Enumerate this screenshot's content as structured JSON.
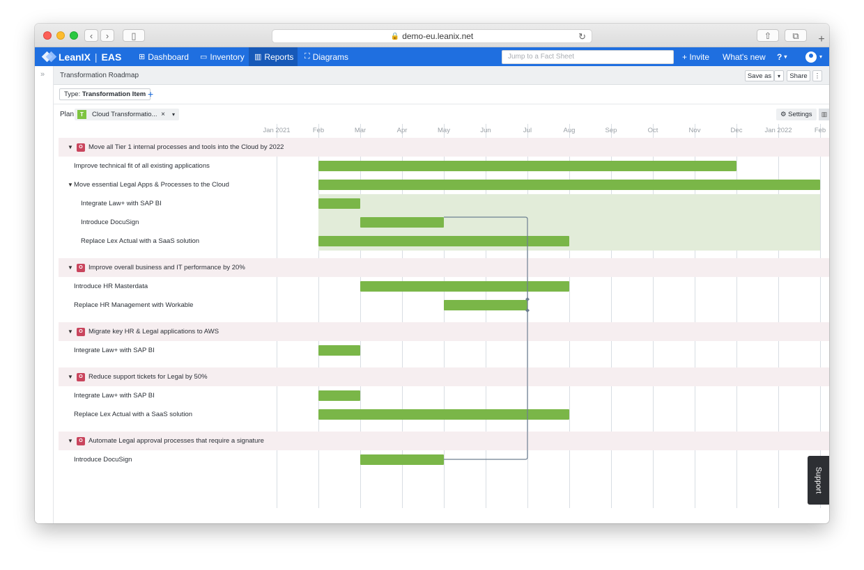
{
  "browser": {
    "url": "demo-eu.leanix.net"
  },
  "nav": {
    "brand": "LeanIX",
    "product": "EAS",
    "items": [
      {
        "label": "Dashboard",
        "icon": "grid-icon",
        "glyph": "⊞"
      },
      {
        "label": "Inventory",
        "icon": "inventory-icon",
        "glyph": "▭"
      },
      {
        "label": "Reports",
        "icon": "reports-icon",
        "glyph": "▥"
      },
      {
        "label": "Diagrams",
        "icon": "diagrams-icon",
        "glyph": "⛶"
      }
    ],
    "search_placeholder": "Jump to a Fact Sheet",
    "invite": "+ Invite",
    "whats_new": "What's new",
    "help": "?"
  },
  "report": {
    "title": "Transformation Roadmap",
    "save_as": "Save as",
    "share": "Share",
    "filter_type_label": "Type:",
    "filter_type_value": "Transformation Item",
    "plan_label": "Plan",
    "plan_badge": "T",
    "plan_value": "Cloud Transformatio...",
    "settings": "Settings"
  },
  "timeline": {
    "months": [
      "Jan 2021",
      "Feb",
      "Mar",
      "Apr",
      "May",
      "Jun",
      "Jul",
      "Aug",
      "Sep",
      "Oct",
      "Nov",
      "Dec",
      "Jan 2022",
      "Feb"
    ]
  },
  "rows": [
    {
      "type": "objective",
      "label": "Move all Tier 1 internal processes and tools into the Cloud by 2022",
      "badge": "O"
    },
    {
      "type": "item",
      "label": "Improve technical fit of all existing applications",
      "indent": 1,
      "start": "2021-02",
      "end": "2021-12"
    },
    {
      "type": "item",
      "label": "Move essential Legal Apps & Processes to the Cloud",
      "indent": 1,
      "expandable": true,
      "start": "2021-02",
      "end": "2022-02"
    },
    {
      "type": "item",
      "label": "Integrate Law+ with SAP BI",
      "indent": 2,
      "start": "2021-02",
      "end": "2021-03"
    },
    {
      "type": "item",
      "label": "Introduce DocuSign",
      "indent": 2,
      "start": "2021-03",
      "end": "2021-05"
    },
    {
      "type": "item",
      "label": "Replace Lex Actual with a SaaS solution",
      "indent": 2,
      "start": "2021-02",
      "end": "2021-08"
    },
    {
      "type": "objective",
      "label": "Improve overall business and IT performance by 20%",
      "badge": "O"
    },
    {
      "type": "item",
      "label": "Introduce HR Masterdata",
      "indent": 1,
      "start": "2021-03",
      "end": "2021-08"
    },
    {
      "type": "item",
      "label": "Replace HR Management with Workable",
      "indent": 1,
      "start": "2021-05",
      "end": "2021-07"
    },
    {
      "type": "objective",
      "label": "Migrate key HR & Legal applications to AWS",
      "badge": "O"
    },
    {
      "type": "item",
      "label": "Integrate Law+ with SAP BI",
      "indent": 1,
      "start": "2021-02",
      "end": "2021-03"
    },
    {
      "type": "objective",
      "label": "Reduce support tickets for Legal by 50%",
      "badge": "O"
    },
    {
      "type": "item",
      "label": "Integrate Law+ with SAP BI",
      "indent": 1,
      "start": "2021-02",
      "end": "2021-03"
    },
    {
      "type": "item",
      "label": "Replace Lex Actual with a SaaS solution",
      "indent": 1,
      "start": "2021-02",
      "end": "2021-08"
    },
    {
      "type": "objective",
      "label": "Automate Legal approval processes that require a signature",
      "badge": "O"
    },
    {
      "type": "item",
      "label": "Introduce DocuSign",
      "indent": 1,
      "start": "2021-03",
      "end": "2021-05"
    }
  ],
  "support": "Support",
  "colors": {
    "brand": "#1f6fe0",
    "bar": "#7ab648",
    "objective_row": "#f6eef0",
    "objective_badge": "#c9455d",
    "group_region": "#e2ecd9"
  }
}
